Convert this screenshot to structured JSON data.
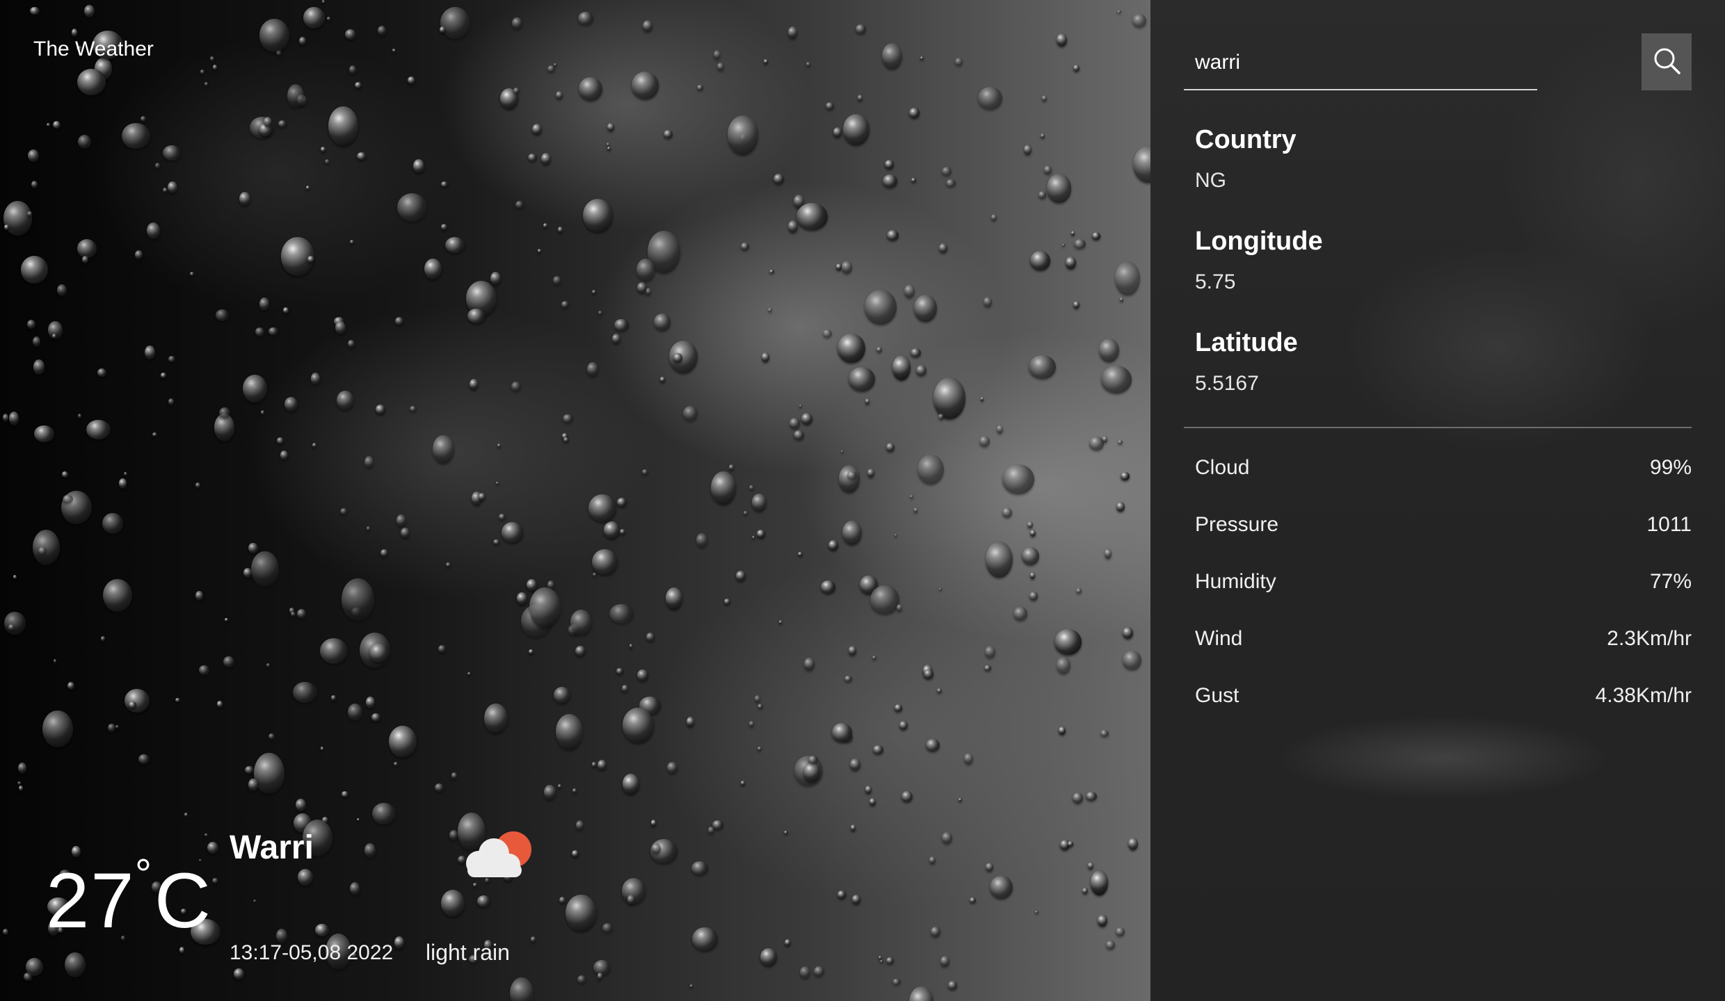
{
  "app": {
    "title": "The Weather"
  },
  "search": {
    "value": "warri",
    "icon": "search-icon"
  },
  "location": {
    "country_label": "Country",
    "country_value": "NG",
    "longitude_label": "Longitude",
    "longitude_value": "5.75",
    "latitude_label": "Latitude",
    "latitude_value": "5.5167"
  },
  "details": [
    {
      "label": "Cloud",
      "value": "99%"
    },
    {
      "label": "Pressure",
      "value": "1011"
    },
    {
      "label": "Humidity",
      "value": "77%"
    },
    {
      "label": "Wind",
      "value": "2.3Km/hr"
    },
    {
      "label": "Gust",
      "value": "4.38Km/hr"
    }
  ],
  "current": {
    "temperature": "27",
    "degree_symbol": "°",
    "unit": "C",
    "city": "Warri",
    "datetime": "13:17-05,08 2022",
    "condition": "light rain",
    "icon": "cloud-sun-icon"
  },
  "colors": {
    "panel_bg": "#2b2b2b",
    "search_button_bg": "#555555",
    "sun": "#e8593c",
    "cloud": "#ececec",
    "text": "#ffffff"
  }
}
